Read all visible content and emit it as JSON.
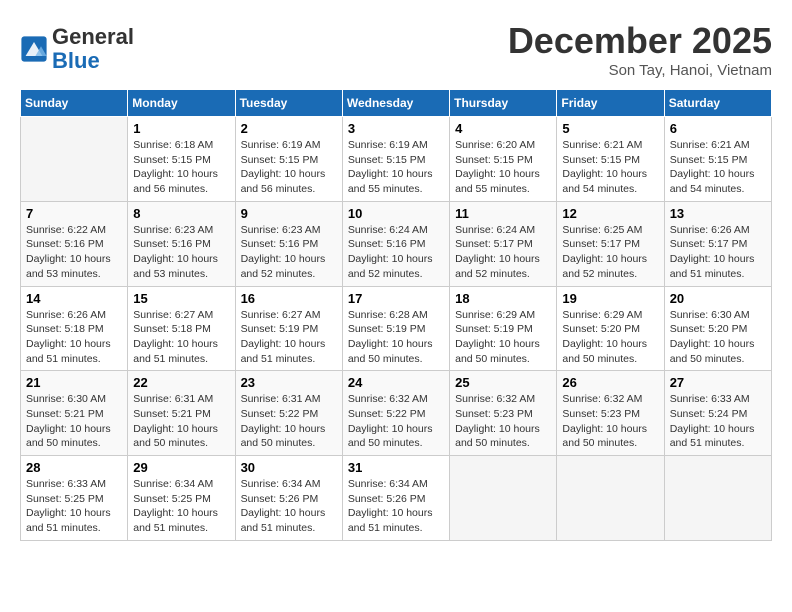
{
  "header": {
    "logo_text_general": "General",
    "logo_text_blue": "Blue",
    "month": "December 2025",
    "location": "Son Tay, Hanoi, Vietnam"
  },
  "weekdays": [
    "Sunday",
    "Monday",
    "Tuesday",
    "Wednesday",
    "Thursday",
    "Friday",
    "Saturday"
  ],
  "weeks": [
    [
      {
        "day": "",
        "info": ""
      },
      {
        "day": "1",
        "info": "Sunrise: 6:18 AM\nSunset: 5:15 PM\nDaylight: 10 hours\nand 56 minutes."
      },
      {
        "day": "2",
        "info": "Sunrise: 6:19 AM\nSunset: 5:15 PM\nDaylight: 10 hours\nand 56 minutes."
      },
      {
        "day": "3",
        "info": "Sunrise: 6:19 AM\nSunset: 5:15 PM\nDaylight: 10 hours\nand 55 minutes."
      },
      {
        "day": "4",
        "info": "Sunrise: 6:20 AM\nSunset: 5:15 PM\nDaylight: 10 hours\nand 55 minutes."
      },
      {
        "day": "5",
        "info": "Sunrise: 6:21 AM\nSunset: 5:15 PM\nDaylight: 10 hours\nand 54 minutes."
      },
      {
        "day": "6",
        "info": "Sunrise: 6:21 AM\nSunset: 5:15 PM\nDaylight: 10 hours\nand 54 minutes."
      }
    ],
    [
      {
        "day": "7",
        "info": "Sunrise: 6:22 AM\nSunset: 5:16 PM\nDaylight: 10 hours\nand 53 minutes."
      },
      {
        "day": "8",
        "info": "Sunrise: 6:23 AM\nSunset: 5:16 PM\nDaylight: 10 hours\nand 53 minutes."
      },
      {
        "day": "9",
        "info": "Sunrise: 6:23 AM\nSunset: 5:16 PM\nDaylight: 10 hours\nand 52 minutes."
      },
      {
        "day": "10",
        "info": "Sunrise: 6:24 AM\nSunset: 5:16 PM\nDaylight: 10 hours\nand 52 minutes."
      },
      {
        "day": "11",
        "info": "Sunrise: 6:24 AM\nSunset: 5:17 PM\nDaylight: 10 hours\nand 52 minutes."
      },
      {
        "day": "12",
        "info": "Sunrise: 6:25 AM\nSunset: 5:17 PM\nDaylight: 10 hours\nand 52 minutes."
      },
      {
        "day": "13",
        "info": "Sunrise: 6:26 AM\nSunset: 5:17 PM\nDaylight: 10 hours\nand 51 minutes."
      }
    ],
    [
      {
        "day": "14",
        "info": "Sunrise: 6:26 AM\nSunset: 5:18 PM\nDaylight: 10 hours\nand 51 minutes."
      },
      {
        "day": "15",
        "info": "Sunrise: 6:27 AM\nSunset: 5:18 PM\nDaylight: 10 hours\nand 51 minutes."
      },
      {
        "day": "16",
        "info": "Sunrise: 6:27 AM\nSunset: 5:19 PM\nDaylight: 10 hours\nand 51 minutes."
      },
      {
        "day": "17",
        "info": "Sunrise: 6:28 AM\nSunset: 5:19 PM\nDaylight: 10 hours\nand 50 minutes."
      },
      {
        "day": "18",
        "info": "Sunrise: 6:29 AM\nSunset: 5:19 PM\nDaylight: 10 hours\nand 50 minutes."
      },
      {
        "day": "19",
        "info": "Sunrise: 6:29 AM\nSunset: 5:20 PM\nDaylight: 10 hours\nand 50 minutes."
      },
      {
        "day": "20",
        "info": "Sunrise: 6:30 AM\nSunset: 5:20 PM\nDaylight: 10 hours\nand 50 minutes."
      }
    ],
    [
      {
        "day": "21",
        "info": "Sunrise: 6:30 AM\nSunset: 5:21 PM\nDaylight: 10 hours\nand 50 minutes."
      },
      {
        "day": "22",
        "info": "Sunrise: 6:31 AM\nSunset: 5:21 PM\nDaylight: 10 hours\nand 50 minutes."
      },
      {
        "day": "23",
        "info": "Sunrise: 6:31 AM\nSunset: 5:22 PM\nDaylight: 10 hours\nand 50 minutes."
      },
      {
        "day": "24",
        "info": "Sunrise: 6:32 AM\nSunset: 5:22 PM\nDaylight: 10 hours\nand 50 minutes."
      },
      {
        "day": "25",
        "info": "Sunrise: 6:32 AM\nSunset: 5:23 PM\nDaylight: 10 hours\nand 50 minutes."
      },
      {
        "day": "26",
        "info": "Sunrise: 6:32 AM\nSunset: 5:23 PM\nDaylight: 10 hours\nand 50 minutes."
      },
      {
        "day": "27",
        "info": "Sunrise: 6:33 AM\nSunset: 5:24 PM\nDaylight: 10 hours\nand 51 minutes."
      }
    ],
    [
      {
        "day": "28",
        "info": "Sunrise: 6:33 AM\nSunset: 5:25 PM\nDaylight: 10 hours\nand 51 minutes."
      },
      {
        "day": "29",
        "info": "Sunrise: 6:34 AM\nSunset: 5:25 PM\nDaylight: 10 hours\nand 51 minutes."
      },
      {
        "day": "30",
        "info": "Sunrise: 6:34 AM\nSunset: 5:26 PM\nDaylight: 10 hours\nand 51 minutes."
      },
      {
        "day": "31",
        "info": "Sunrise: 6:34 AM\nSunset: 5:26 PM\nDaylight: 10 hours\nand 51 minutes."
      },
      {
        "day": "",
        "info": ""
      },
      {
        "day": "",
        "info": ""
      },
      {
        "day": "",
        "info": ""
      }
    ]
  ]
}
